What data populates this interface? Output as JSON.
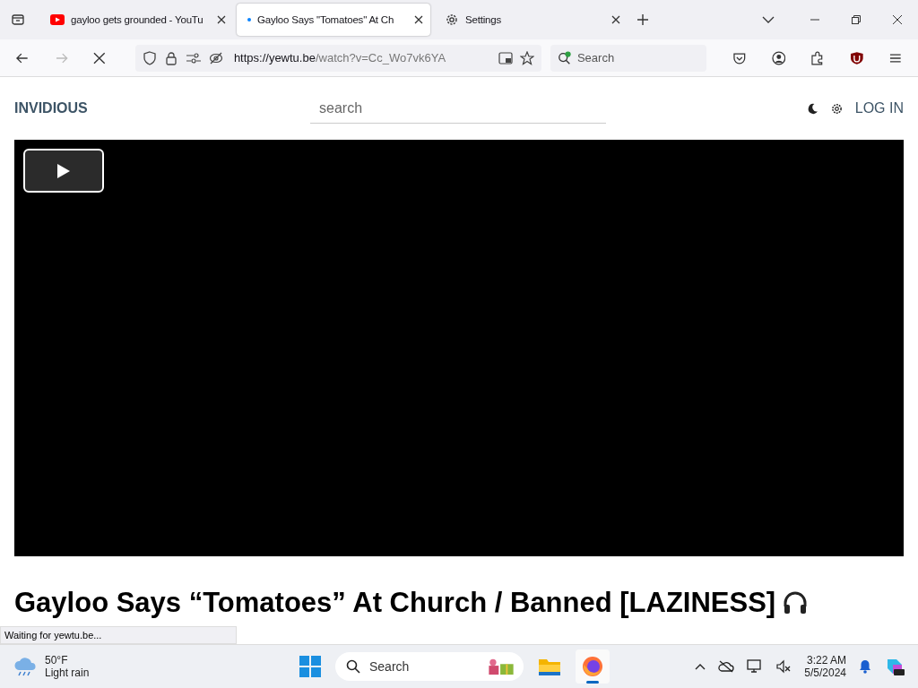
{
  "tabs": [
    {
      "title": "gayloo gets grounded - YouTu",
      "kind": "video",
      "selected": false,
      "loading": false
    },
    {
      "title": "Gayloo Says \"Tomatoes\" At Ch",
      "kind": "page",
      "selected": true,
      "loading": true
    },
    {
      "title": "Settings",
      "kind": "settings",
      "selected": false,
      "loading": false
    }
  ],
  "address_bar": {
    "url_host": "https://yewtu.be",
    "url_path": "/watch?v=Cc_Wo7vk6YA"
  },
  "search_field": {
    "placeholder": "Search"
  },
  "page": {
    "logo": "INVIDIOUS",
    "search_placeholder": "search",
    "login": "LOG IN",
    "video_title": "Gayloo Says “Tomatoes” At Church / Banned [LAZINESS]"
  },
  "status_text": "Waiting for yewtu.be...",
  "taskbar": {
    "weather_temp": "50°F",
    "weather_desc": "Light rain",
    "search_placeholder": "Search",
    "time": "3:22 AM",
    "date": "5/5/2024"
  }
}
